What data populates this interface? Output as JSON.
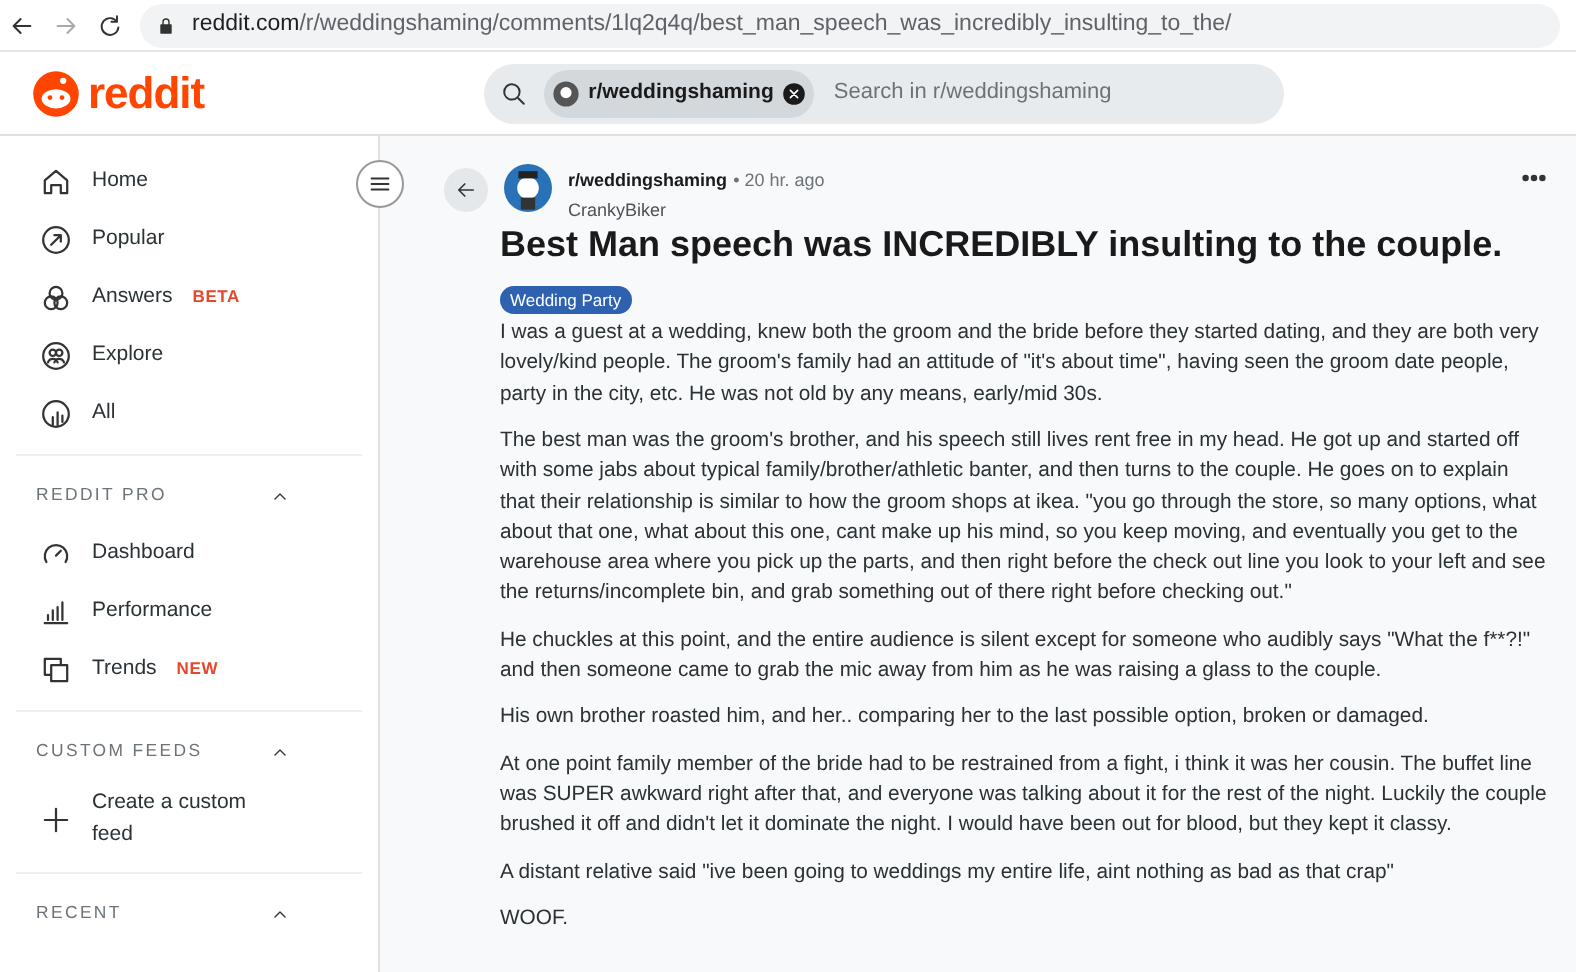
{
  "browser": {
    "url_host": "reddit.com",
    "url_path": "/r/weddingshaming/comments/1lq2q4q/best_man_speech_was_incredibly_insulting_to_the/"
  },
  "header": {
    "logo": "reddit",
    "search_chip": "r/weddingshaming",
    "search_placeholder": "Search in r/weddingshaming"
  },
  "sidebar": {
    "items": [
      {
        "label": "Home"
      },
      {
        "label": "Popular"
      },
      {
        "label": "Answers",
        "badge": "BETA"
      },
      {
        "label": "Explore"
      },
      {
        "label": "All"
      }
    ],
    "sections": [
      {
        "title": "REDDIT PRO",
        "expanded": true,
        "items": [
          {
            "label": "Dashboard"
          },
          {
            "label": "Performance"
          },
          {
            "label": "Trends",
            "badge": "NEW"
          }
        ]
      },
      {
        "title": "CUSTOM FEEDS",
        "expanded": true,
        "items": [
          {
            "label": "Create a custom feed"
          }
        ]
      },
      {
        "title": "RECENT",
        "expanded": true
      }
    ]
  },
  "post": {
    "subreddit": "r/weddingshaming",
    "age": "• 20 hr. ago",
    "author": "CrankyBiker",
    "title": "Best Man speech was INCREDIBLY insulting to the couple.",
    "flair": "Wedding Party",
    "paragraphs": [
      "I was a guest at a wedding, knew both the groom and the bride before they started dating, and they are both very lovely/kind people. The groom's family had an attitude of \"it's about time\", having seen the groom date people, party in the city, etc. He was not old by any means, early/mid 30s.",
      "The best man was the groom's brother, and his speech still lives rent free in my head. He got up and started off with some jabs about typical family/brother/athletic banter, and then turns to the couple. He goes on to explain that their relationship is similar to how the groom shops at ikea. \"you go through the store, so many options, what about that one, what about this one, cant make up his mind, so you keep moving, and eventually you get to the warehouse area where you pick up the parts, and then right before the check out line you look to your left and see the returns/incomplete bin, and grab something out of there right before checking out.\"",
      "He chuckles at this point, and the entire audience is silent except for someone who audibly says \"What the f**?!\" and then someone came to grab the mic away from him as he was raising a glass to the couple.",
      "His own brother roasted him, and her.. comparing her to the last possible option, broken or damaged.",
      "At one point family member of the bride had to be restrained from a fight, i think it was her cousin. The buffet line was SUPER awkward right after that, and everyone was talking about it for the rest of the night. Luckily the couple brushed it off and didn't let it dominate the night. I would have been out for blood, but they kept it classy.",
      "A distant relative said \"ive been going to weddings my entire life, aint nothing as bad as that crap\"",
      "WOOF."
    ]
  }
}
